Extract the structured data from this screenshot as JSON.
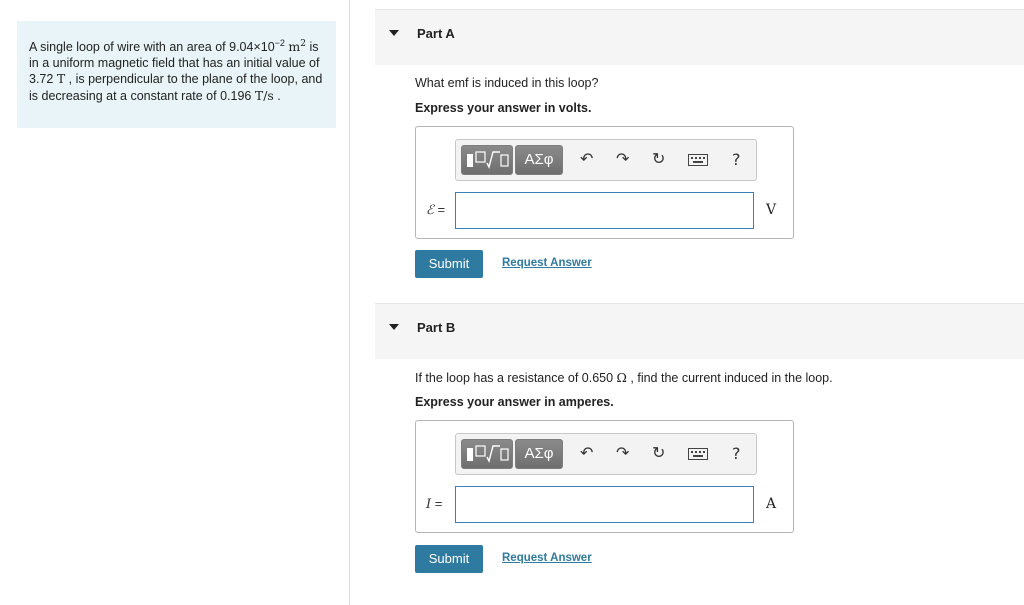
{
  "problem": {
    "text_1": "A single loop of wire with an area of ",
    "area_value": "9.04×10",
    "area_exp": "−2",
    "area_unit": "m",
    "area_unit_exp": "2",
    "text_2": " is in a uniform magnetic field that has an initial value of ",
    "field_value": "3.72",
    "field_unit": "T",
    "text_3": " , is perpendicular to the plane of the loop, and is decreasing at a constant rate of ",
    "rate_value": "0.196",
    "rate_unit": "T/s",
    "text_4": " ."
  },
  "toolbar": {
    "greek_label": "ΑΣφ",
    "help_label": "?"
  },
  "part_a": {
    "title": "Part A",
    "question": "What emf is induced in this loop?",
    "instruction": "Express your answer in volts.",
    "var_symbol": "ℰ",
    "var_eq": " =",
    "input_value": "",
    "unit": "V",
    "submit_label": "Submit",
    "request_label": "Request Answer"
  },
  "part_b": {
    "title": "Part B",
    "question_1": "If the loop has a resistance of ",
    "resistance_value": "0.650",
    "resistance_unit": "Ω",
    "question_2": " , find the current induced in the loop.",
    "instruction": "Express your answer in amperes.",
    "var_symbol": "I",
    "var_eq": " =",
    "input_value": "",
    "unit": "A",
    "submit_label": "Submit",
    "request_label": "Request Answer"
  }
}
